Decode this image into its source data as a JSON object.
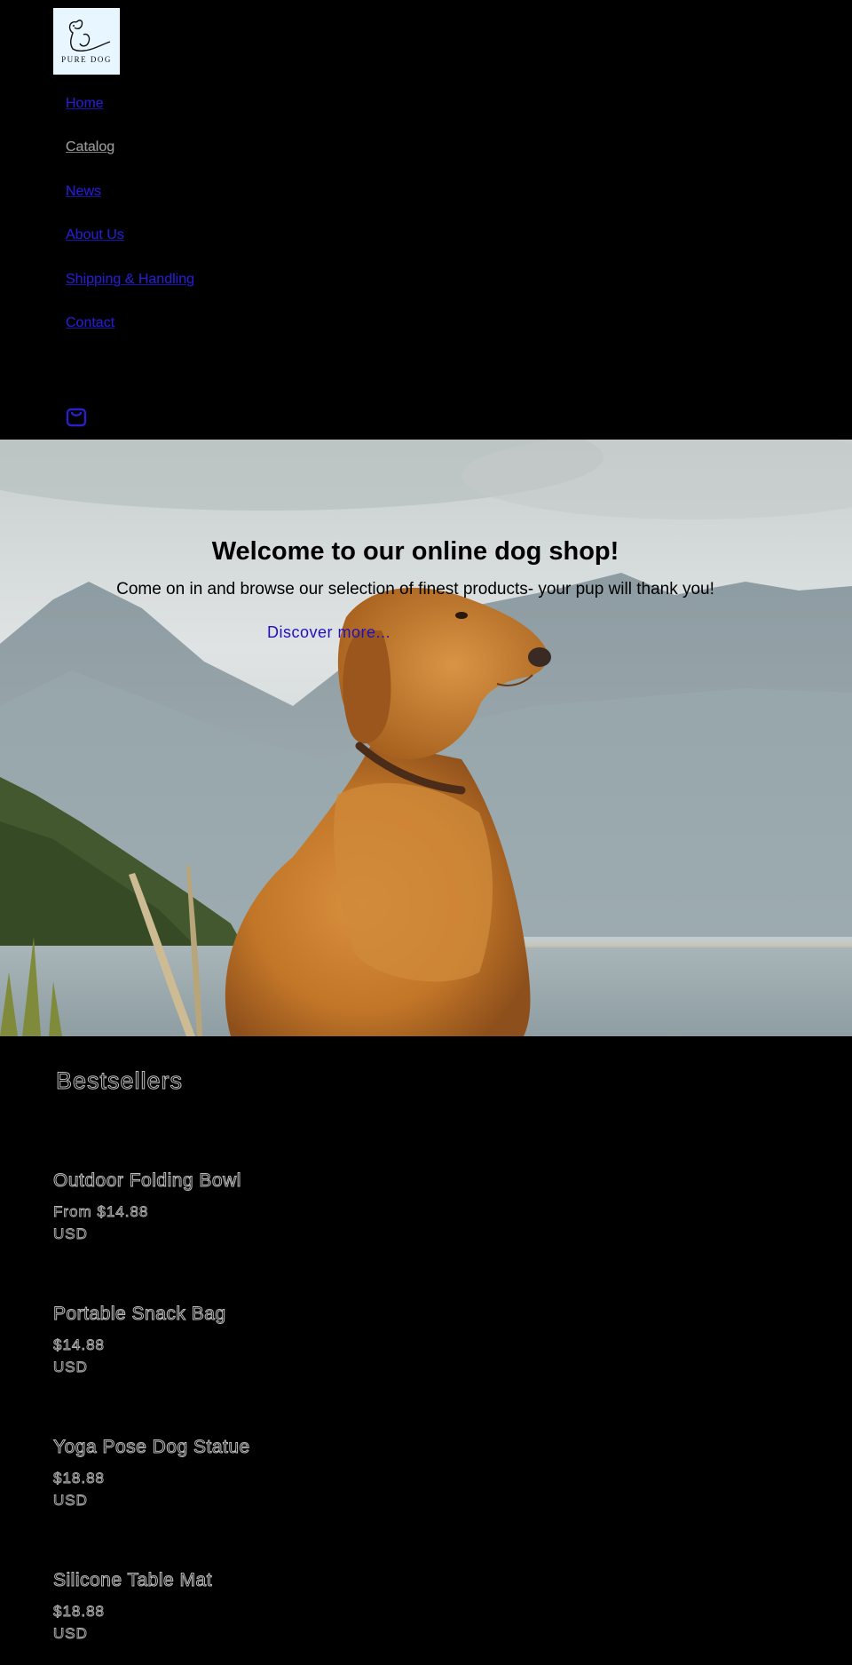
{
  "brand": {
    "logo_text": "PURE DOG"
  },
  "nav": {
    "items": [
      {
        "label": "Home"
      },
      {
        "label": "Catalog"
      },
      {
        "label": "News"
      },
      {
        "label": "About Us"
      },
      {
        "label": "Shipping & Handling"
      },
      {
        "label": "Contact"
      }
    ],
    "cart_icon": "shopping-bag-icon"
  },
  "hero": {
    "title": "Welcome to our online dog shop!",
    "subtitle": "Come on in and browse our selection of finest products- your pup will thank you!",
    "link_label": "Discover more..."
  },
  "bestsellers": {
    "title": "Bestsellers",
    "products": [
      {
        "name": "Outdoor Folding Bowl",
        "price": "From $14.88",
        "currency": "USD"
      },
      {
        "name": "Portable Snack Bag",
        "price": "$14.88",
        "currency": "USD"
      },
      {
        "name": "Yoga Pose Dog Statue",
        "price": "$18.88",
        "currency": "USD"
      },
      {
        "name": "Silicone Table Mat",
        "price": "$18.88",
        "currency": "USD"
      }
    ]
  },
  "colors": {
    "background": "#000000",
    "link": "#2b1fc8",
    "logo_bg": "#e8f6ff"
  }
}
